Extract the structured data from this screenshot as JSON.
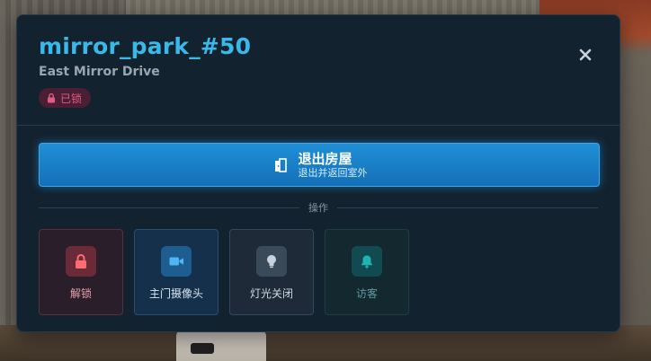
{
  "header": {
    "title": "mirror_park_#50",
    "subtitle": "East Mirror Drive",
    "status_badge": "已锁",
    "close_icon": "close-icon"
  },
  "exit": {
    "title": "退出房屋",
    "subtitle": "退出并返回室外",
    "icon": "door-exit-icon"
  },
  "section_label": "操作",
  "actions": [
    {
      "label": "解锁",
      "icon": "lock-icon",
      "color": "#e8525c"
    },
    {
      "label": "主门摄像头",
      "icon": "video-camera-icon",
      "color": "#3aa9ee"
    },
    {
      "label": "灯光关闭",
      "icon": "lightbulb-icon",
      "color": "#b8c4cf"
    },
    {
      "label": "访客",
      "icon": "bell-icon",
      "color": "#1aa6a6"
    }
  ],
  "colors": {
    "accent": "#39b8ea",
    "panel_bg": "#13222f",
    "exit_button": "#1a80c8",
    "badge_text": "#e35a85"
  }
}
